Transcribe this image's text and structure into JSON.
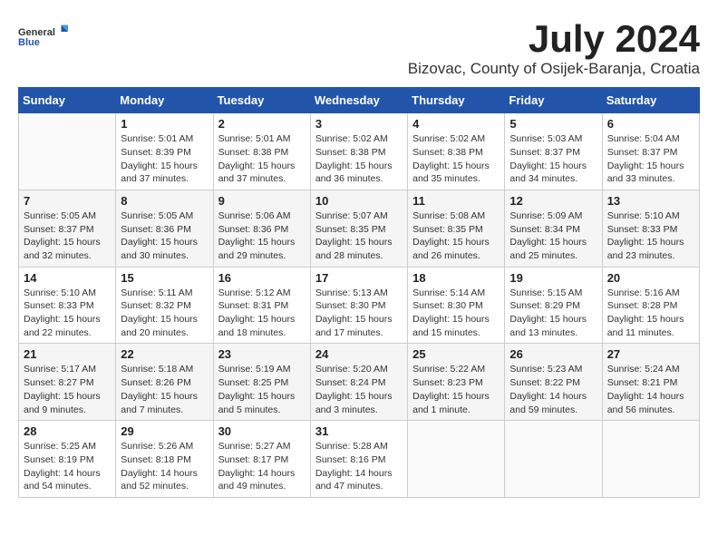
{
  "header": {
    "logo_general": "General",
    "logo_blue": "Blue",
    "month": "July 2024",
    "location": "Bizovac, County of Osijek-Baranja, Croatia"
  },
  "weekdays": [
    "Sunday",
    "Monday",
    "Tuesday",
    "Wednesday",
    "Thursday",
    "Friday",
    "Saturday"
  ],
  "weeks": [
    [
      {
        "day": "",
        "info": ""
      },
      {
        "day": "1",
        "info": "Sunrise: 5:01 AM\nSunset: 8:39 PM\nDaylight: 15 hours\nand 37 minutes."
      },
      {
        "day": "2",
        "info": "Sunrise: 5:01 AM\nSunset: 8:38 PM\nDaylight: 15 hours\nand 37 minutes."
      },
      {
        "day": "3",
        "info": "Sunrise: 5:02 AM\nSunset: 8:38 PM\nDaylight: 15 hours\nand 36 minutes."
      },
      {
        "day": "4",
        "info": "Sunrise: 5:02 AM\nSunset: 8:38 PM\nDaylight: 15 hours\nand 35 minutes."
      },
      {
        "day": "5",
        "info": "Sunrise: 5:03 AM\nSunset: 8:37 PM\nDaylight: 15 hours\nand 34 minutes."
      },
      {
        "day": "6",
        "info": "Sunrise: 5:04 AM\nSunset: 8:37 PM\nDaylight: 15 hours\nand 33 minutes."
      }
    ],
    [
      {
        "day": "7",
        "info": "Sunrise: 5:05 AM\nSunset: 8:37 PM\nDaylight: 15 hours\nand 32 minutes."
      },
      {
        "day": "8",
        "info": "Sunrise: 5:05 AM\nSunset: 8:36 PM\nDaylight: 15 hours\nand 30 minutes."
      },
      {
        "day": "9",
        "info": "Sunrise: 5:06 AM\nSunset: 8:36 PM\nDaylight: 15 hours\nand 29 minutes."
      },
      {
        "day": "10",
        "info": "Sunrise: 5:07 AM\nSunset: 8:35 PM\nDaylight: 15 hours\nand 28 minutes."
      },
      {
        "day": "11",
        "info": "Sunrise: 5:08 AM\nSunset: 8:35 PM\nDaylight: 15 hours\nand 26 minutes."
      },
      {
        "day": "12",
        "info": "Sunrise: 5:09 AM\nSunset: 8:34 PM\nDaylight: 15 hours\nand 25 minutes."
      },
      {
        "day": "13",
        "info": "Sunrise: 5:10 AM\nSunset: 8:33 PM\nDaylight: 15 hours\nand 23 minutes."
      }
    ],
    [
      {
        "day": "14",
        "info": "Sunrise: 5:10 AM\nSunset: 8:33 PM\nDaylight: 15 hours\nand 22 minutes."
      },
      {
        "day": "15",
        "info": "Sunrise: 5:11 AM\nSunset: 8:32 PM\nDaylight: 15 hours\nand 20 minutes."
      },
      {
        "day": "16",
        "info": "Sunrise: 5:12 AM\nSunset: 8:31 PM\nDaylight: 15 hours\nand 18 minutes."
      },
      {
        "day": "17",
        "info": "Sunrise: 5:13 AM\nSunset: 8:30 PM\nDaylight: 15 hours\nand 17 minutes."
      },
      {
        "day": "18",
        "info": "Sunrise: 5:14 AM\nSunset: 8:30 PM\nDaylight: 15 hours\nand 15 minutes."
      },
      {
        "day": "19",
        "info": "Sunrise: 5:15 AM\nSunset: 8:29 PM\nDaylight: 15 hours\nand 13 minutes."
      },
      {
        "day": "20",
        "info": "Sunrise: 5:16 AM\nSunset: 8:28 PM\nDaylight: 15 hours\nand 11 minutes."
      }
    ],
    [
      {
        "day": "21",
        "info": "Sunrise: 5:17 AM\nSunset: 8:27 PM\nDaylight: 15 hours\nand 9 minutes."
      },
      {
        "day": "22",
        "info": "Sunrise: 5:18 AM\nSunset: 8:26 PM\nDaylight: 15 hours\nand 7 minutes."
      },
      {
        "day": "23",
        "info": "Sunrise: 5:19 AM\nSunset: 8:25 PM\nDaylight: 15 hours\nand 5 minutes."
      },
      {
        "day": "24",
        "info": "Sunrise: 5:20 AM\nSunset: 8:24 PM\nDaylight: 15 hours\nand 3 minutes."
      },
      {
        "day": "25",
        "info": "Sunrise: 5:22 AM\nSunset: 8:23 PM\nDaylight: 15 hours\nand 1 minute."
      },
      {
        "day": "26",
        "info": "Sunrise: 5:23 AM\nSunset: 8:22 PM\nDaylight: 14 hours\nand 59 minutes."
      },
      {
        "day": "27",
        "info": "Sunrise: 5:24 AM\nSunset: 8:21 PM\nDaylight: 14 hours\nand 56 minutes."
      }
    ],
    [
      {
        "day": "28",
        "info": "Sunrise: 5:25 AM\nSunset: 8:19 PM\nDaylight: 14 hours\nand 54 minutes."
      },
      {
        "day": "29",
        "info": "Sunrise: 5:26 AM\nSunset: 8:18 PM\nDaylight: 14 hours\nand 52 minutes."
      },
      {
        "day": "30",
        "info": "Sunrise: 5:27 AM\nSunset: 8:17 PM\nDaylight: 14 hours\nand 49 minutes."
      },
      {
        "day": "31",
        "info": "Sunrise: 5:28 AM\nSunset: 8:16 PM\nDaylight: 14 hours\nand 47 minutes."
      },
      {
        "day": "",
        "info": ""
      },
      {
        "day": "",
        "info": ""
      },
      {
        "day": "",
        "info": ""
      }
    ]
  ]
}
